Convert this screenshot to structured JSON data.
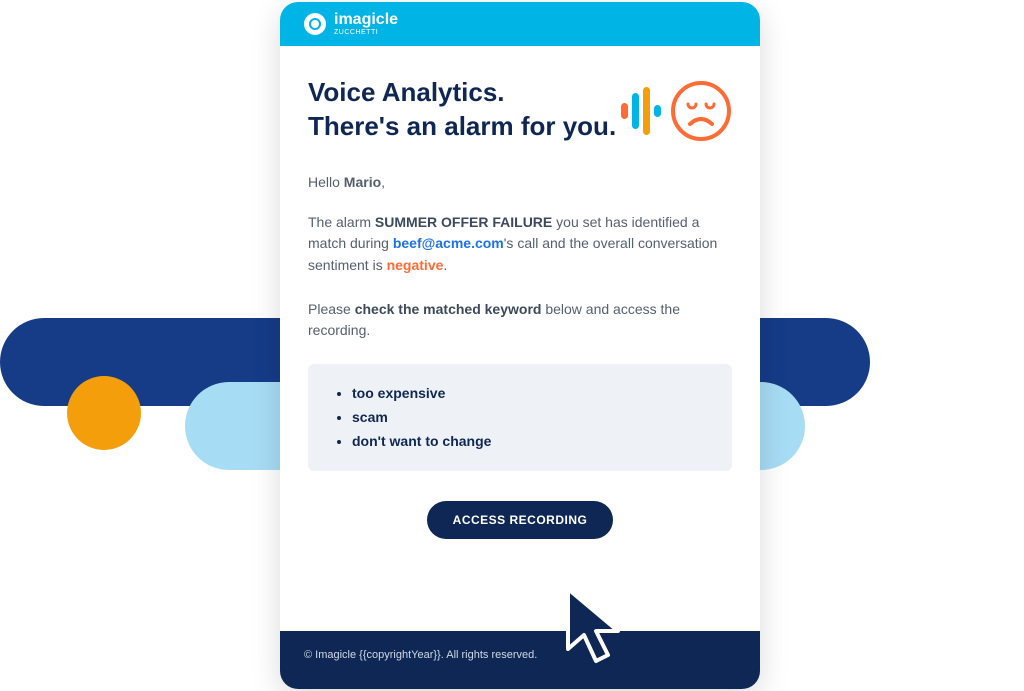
{
  "brand": {
    "name": "imagicle",
    "sub": "ZUCCHETTI"
  },
  "title": "Voice Analytics.\nThere's an alarm for you.",
  "greeting_prefix": "Hello ",
  "user_name": "Mario",
  "greeting_suffix": ",",
  "alarm": {
    "line1_a": "The alarm ",
    "name": "SUMMER OFFER FAILURE",
    "line1_b": " you set has identified a match during ",
    "email": "beef@acme.com",
    "line1_c": "'s call and the overall conversation sentiment is ",
    "sentiment": "negative",
    "line1_d": "."
  },
  "instruction": {
    "pre": "Please ",
    "bold": "check the matched keyword",
    "post": " below and access the recording."
  },
  "keywords": [
    "too expensive",
    "scam",
    "don't want to change"
  ],
  "cta": "ACCESS RECORDING",
  "footer": "© Imagicle {{copyrightYear}}. All rights reserved."
}
